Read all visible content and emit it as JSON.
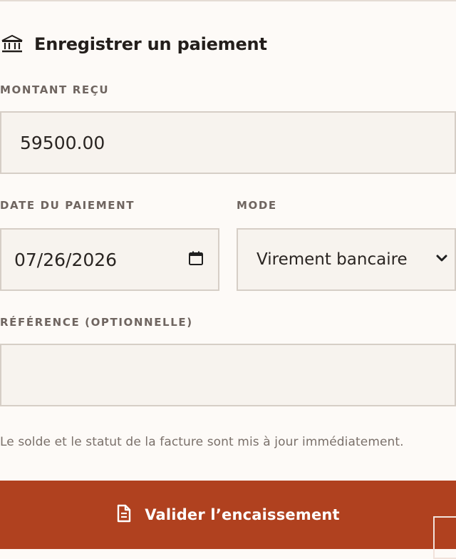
{
  "form": {
    "title": "Enregistrer un paiement",
    "title_icon": "bank-icon"
  },
  "amount": {
    "label": "MONTANT REÇU",
    "value": "59500.00"
  },
  "date": {
    "label": "DATE DU PAIEMENT",
    "value": "07/26/2026",
    "icon": "calendar-icon"
  },
  "mode": {
    "label": "MODE",
    "selected": "Virement bancaire",
    "icon": "chevron-down-icon"
  },
  "reference": {
    "label": "RÉFÉRENCE (OPTIONNELLE)",
    "value": ""
  },
  "hint": "Le solde et le statut de la facture sont mis à jour immédiatement.",
  "submit": {
    "label": "Valider l’encaissement",
    "icon": "document-icon"
  },
  "colors": {
    "accent": "#b0411f",
    "background": "#fdfaf7",
    "field_background": "#f7f3ee",
    "field_border": "#d6cec6"
  }
}
